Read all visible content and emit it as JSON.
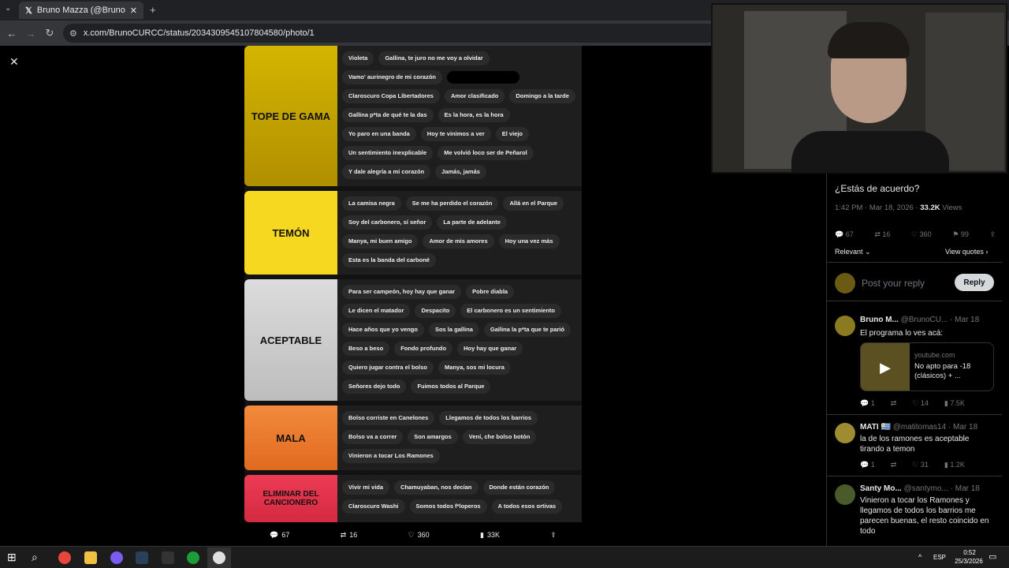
{
  "browser": {
    "tab_title": "Bruno Mazza (@BrunoCURCC)",
    "tab_close": "✕",
    "new_tab": "+",
    "url": "x.com/BrunoCURCC/status/2034309545107804580/photo/1",
    "close_photo": "✕"
  },
  "tiers": [
    {
      "label": "TOPE DE GAMA",
      "color": "#c9a800",
      "items": [
        "Violeta",
        "Gallina, te juro no me voy a olvidar",
        "Vamo' aurinegro de mi corazón",
        "[redacted]",
        "Claroscuro Copa Libertadores",
        "Amor clasificado",
        "Domingo a la tarde",
        "Gallina p*ta de qué te la das",
        "Es la hora, es la hora",
        "Yo paro en una banda",
        "Hoy te vinimos a ver",
        "El viejo",
        "Un sentimiento inexplicable",
        "Me volvió loco ser de Peñarol",
        "Y dale alegría a mi corazón",
        "Jamás, jamás"
      ]
    },
    {
      "label": "TEMÓN",
      "color": "#f5d81f",
      "items": [
        "La camisa negra",
        "Se me ha perdido el corazón",
        "Allá en el Parque",
        "Soy del carbonero, sí señor",
        "La parte de adelante",
        "Manya, mi buen amigo",
        "Amor de mis amores",
        "Hoy una vez más",
        "Esta es la banda del carboné"
      ]
    },
    {
      "label": "ACEPTABLE",
      "color": "#d4d4d4",
      "items": [
        "Para ser campeón, hoy hay que ganar",
        "Pobre diabla",
        "Le dicen el matador",
        "Despacito",
        "El carbonero es un sentimiento",
        "Hace años que yo vengo",
        "Sos la gallina",
        "Gallina la p*ta que te parió",
        "Beso a beso",
        "Fondo profundo",
        "Hoy hay que ganar",
        "Quiero jugar contra el bolso",
        "Manya, sos mi locura",
        "Señores dejo todo",
        "Fuimos todos al Parque"
      ]
    },
    {
      "label": "MALA",
      "color": "#f07c2c",
      "items": [
        "Bolso corriste en Canelones",
        "Llegamos de todos los barrios",
        "Bolso va a correr",
        "Son amargos",
        "Vení, che bolso botón",
        "Vinieron a tocar Los Ramones"
      ]
    },
    {
      "label": "ELIMINAR DEL CANCIONERO",
      "color": "#e8334a",
      "items": [
        "Vivir mi vida",
        "Chamuyaban, nos decían",
        "Donde están corazón",
        "Claroscuro Washi",
        "Somos todos f*loperos",
        "A todos esos ortivas"
      ]
    }
  ],
  "media_stats": {
    "replies": "67",
    "reposts": "16",
    "likes": "360",
    "views": "33K"
  },
  "post": {
    "text": "¿Estás de acuerdo?",
    "time": "1:42 PM · Mar 18, 2026 ·",
    "views_count": "33.2K",
    "views_label": "Views",
    "replies": "67",
    "reposts": "16",
    "likes": "360",
    "bookmarks": "99",
    "relevant": "Relevant",
    "view_quotes": "View quotes",
    "reply_placeholder": "Post your reply",
    "reply_button": "Reply"
  },
  "replies": [
    {
      "name": "Bruno M...",
      "handle": "@BrunoCU...",
      "date": "· Mar 18",
      "text": "El programa lo ves acá:",
      "card_domain": "youtube.com",
      "card_title": "No apto para -18 (clásicos) + ...",
      "r": "1",
      "rt": "",
      "l": "14",
      "v": "7.5K"
    },
    {
      "name": "MATI 🇺🇾",
      "handle": "@matitomas14",
      "date": "· Mar 18",
      "text": "la de los ramones es aceptable tirando a temon",
      "r": "1",
      "rt": "",
      "l": "31",
      "v": "1.2K"
    },
    {
      "name": "Santy Mo...",
      "handle": "@santymo...",
      "date": "· Mar 18",
      "text": "Vinieron a tocar los Ramones y llegamos de todos los barrios me parecen buenas, el resto coincido en todo"
    }
  ],
  "taskbar": {
    "lang": "ESP",
    "time": "0:52",
    "date": "25/3/2026"
  }
}
